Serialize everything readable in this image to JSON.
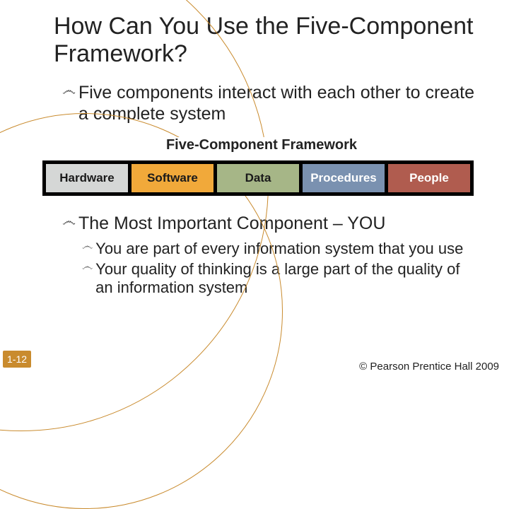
{
  "title": "How Can You Use the Five-Component Framework?",
  "bullets": [
    {
      "text": "Five components interact with each other to create a complete system"
    }
  ],
  "diagram": {
    "heading": "Five-Component Framework",
    "cells": [
      "Hardware",
      "Software",
      "Data",
      "Procedures",
      "People"
    ]
  },
  "bullets2": [
    {
      "text": "The Most Important Component – YOU",
      "subs": [
        "You are part of every information system that you use",
        "Your quality of thinking is a large part of the quality of an information system"
      ]
    }
  ],
  "pageNumber": "1-12",
  "copyright": "© Pearson Prentice Hall 2009"
}
